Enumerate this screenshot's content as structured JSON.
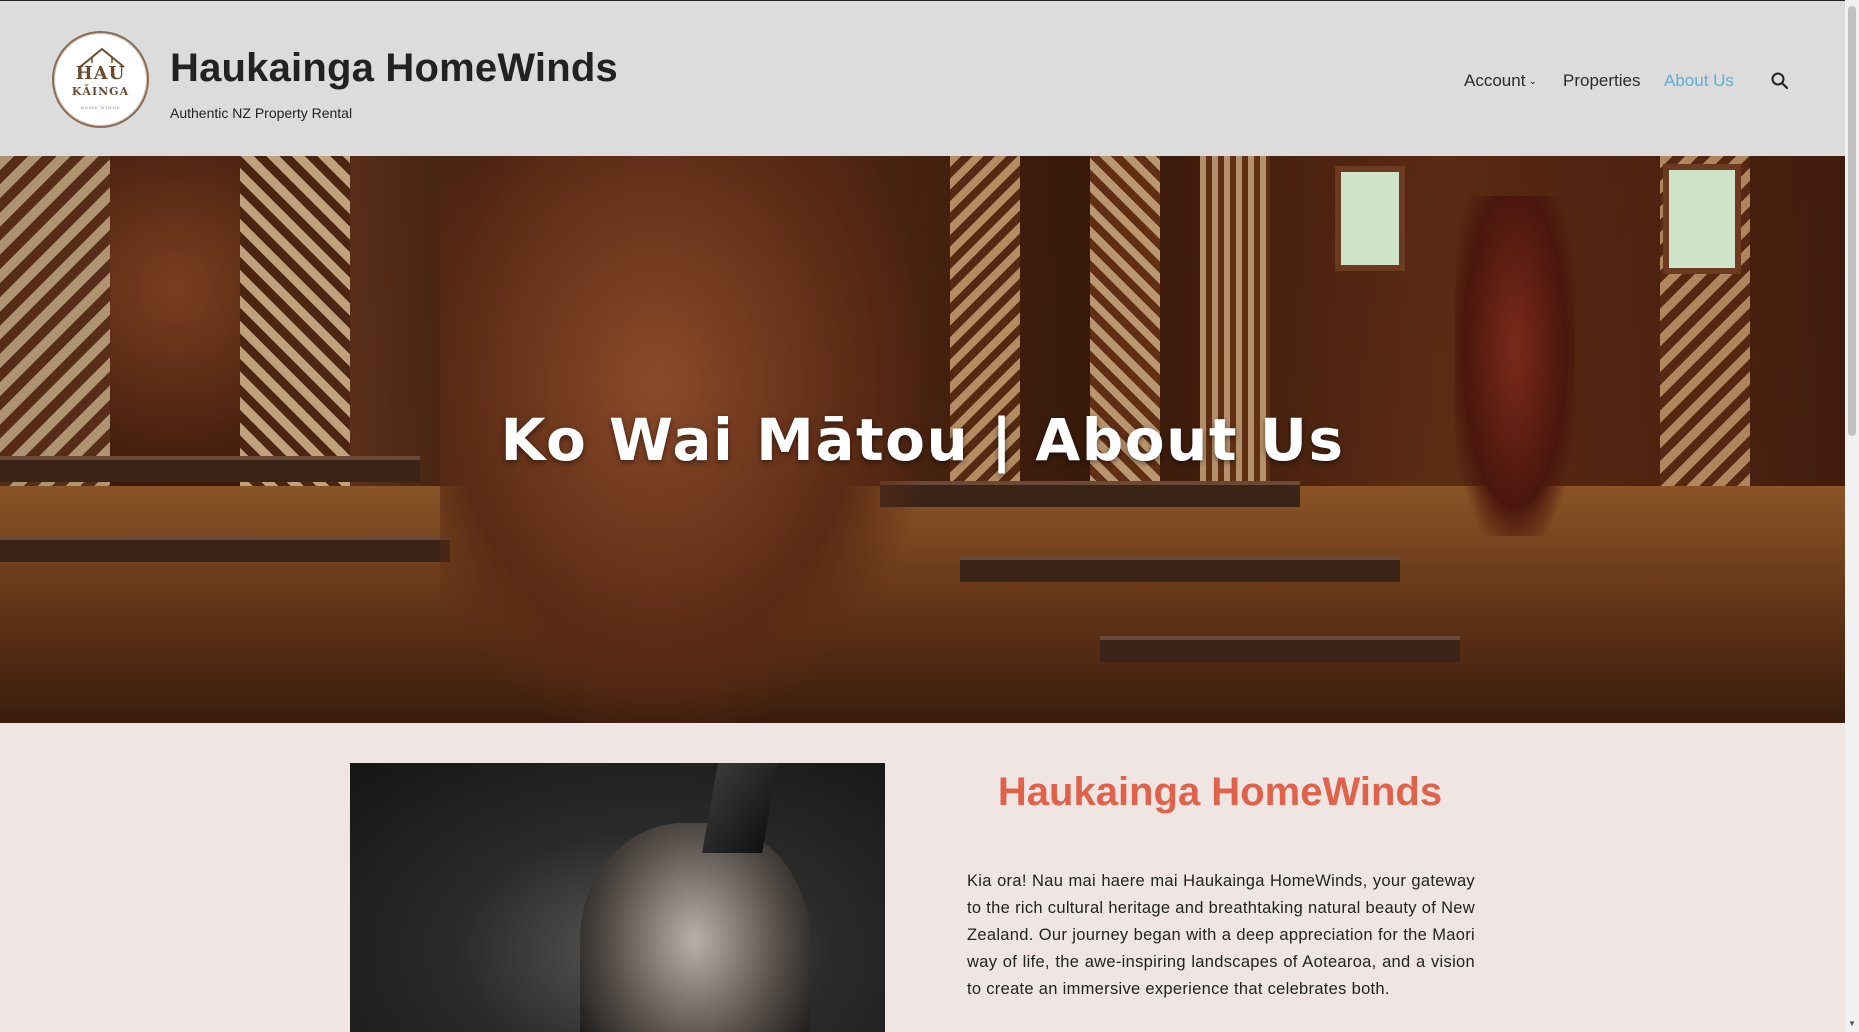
{
  "header": {
    "logo": {
      "line1": "HAU",
      "line2": "KĀINGA",
      "line3": "HOME WINDS"
    },
    "site_title": "Haukainga HomeWinds",
    "tagline": "Authentic NZ Property Rental"
  },
  "nav": {
    "items": [
      {
        "label": "Account",
        "has_dropdown": true
      },
      {
        "label": "Properties"
      },
      {
        "label": "About Us",
        "active": true
      }
    ],
    "search_icon": "search-icon"
  },
  "hero": {
    "title": "Ko Wai Mātou | About Us"
  },
  "main": {
    "section_title": "Haukainga HomeWinds",
    "intro": "Kia ora! Nau mai haere mai Haukainga HomeWinds, your gateway to the rich cultural heritage and breathtaking natural beauty of New Zealand. Our journey began with a deep appreciation for the Maori way of life, the awe-inspiring landscapes of Aotearoa, and a vision to create an immersive experience that celebrates both."
  },
  "colors": {
    "header_bg": "#dcdcdc",
    "page_bg": "#efe6e3",
    "accent": "#e0624a",
    "nav_active": "#5aaed8"
  }
}
